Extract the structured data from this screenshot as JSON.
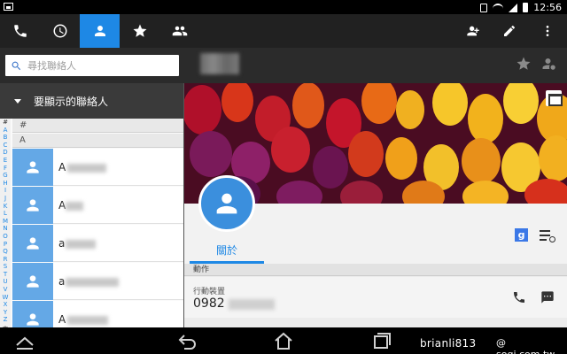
{
  "status_bar": {
    "time": "12:56"
  },
  "tabs": [
    {
      "name": "phone-tab",
      "icon": "phone-icon",
      "active": false
    },
    {
      "name": "recent-tab",
      "icon": "clock-icon",
      "active": false
    },
    {
      "name": "contacts-tab",
      "icon": "person-icon",
      "active": true
    },
    {
      "name": "favorites-tab",
      "icon": "star-icon",
      "active": false
    },
    {
      "name": "groups-tab",
      "icon": "group-icon",
      "active": false
    }
  ],
  "action_icons": [
    "add-contact-icon",
    "edit-icon",
    "overflow-menu-icon"
  ],
  "search": {
    "placeholder": "尋找聯絡人"
  },
  "filter": {
    "label": "要顯示的聯絡人"
  },
  "index_letters": [
    "#",
    "A",
    "B",
    "C",
    "D",
    "E",
    "F",
    "G",
    "H",
    "I",
    "J",
    "K",
    "L",
    "M",
    "N",
    "O",
    "P",
    "Q",
    "R",
    "S",
    "T",
    "U",
    "V",
    "W",
    "X",
    "Y",
    "Z"
  ],
  "index_extra": [
    "中",
    "文"
  ],
  "contact_list": {
    "sections": [
      {
        "header": "#"
      },
      {
        "header": "A"
      }
    ],
    "rows": [
      {
        "initial": "A"
      },
      {
        "initial": "A"
      },
      {
        "initial": "a"
      },
      {
        "initial": "a"
      },
      {
        "initial": "A"
      }
    ]
  },
  "detail": {
    "tab_about": "關於",
    "section_label": "動作",
    "phone": {
      "label": "行動裝置",
      "number_prefix": "0982"
    },
    "badge_google": "g"
  },
  "watermark": {
    "user": "brianli813",
    "site": "@ sogi.com.tw"
  },
  "colors": {
    "accent": "#1e88e5",
    "action_bar": "#212121",
    "avatar": "#64a8e6"
  }
}
